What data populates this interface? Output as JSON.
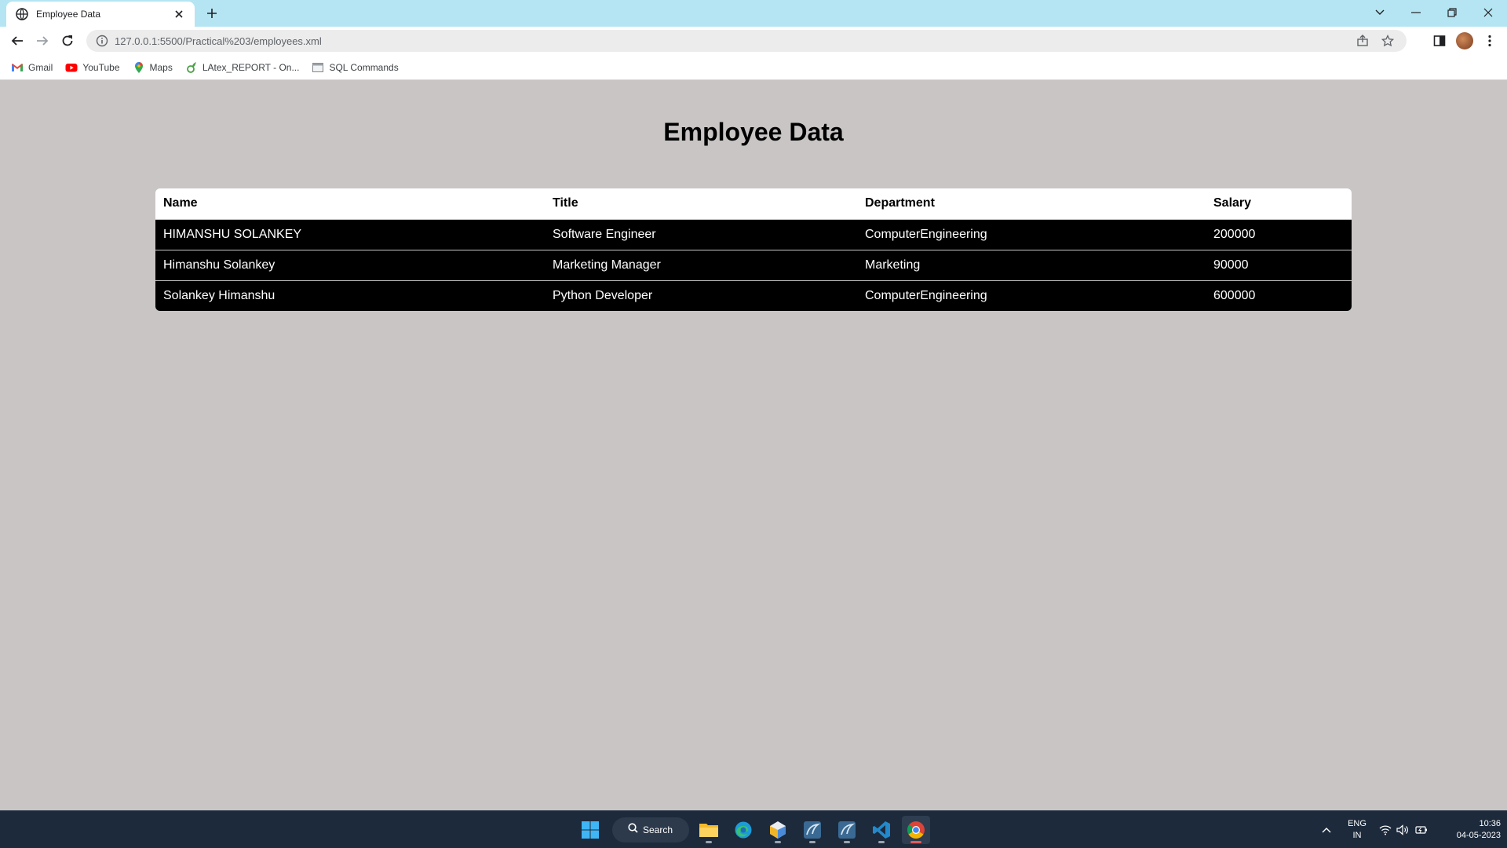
{
  "browser": {
    "tab_title": "Employee Data",
    "url": "127.0.0.1:5500/Practical%203/employees.xml",
    "bookmarks": [
      {
        "label": "Gmail",
        "icon": "gmail-icon"
      },
      {
        "label": "YouTube",
        "icon": "youtube-icon"
      },
      {
        "label": "Maps",
        "icon": "maps-icon"
      },
      {
        "label": "LAtex_REPORT - On...",
        "icon": "overleaf-icon"
      },
      {
        "label": "SQL Commands",
        "icon": "page-icon"
      }
    ]
  },
  "page": {
    "title": "Employee Data",
    "table": {
      "headers": [
        "Name",
        "Title",
        "Department",
        "Salary"
      ],
      "rows": [
        [
          "HIMANSHU SOLANKEY",
          "Software Engineer",
          "ComputerEngineering",
          "200000"
        ],
        [
          "Himanshu Solankey",
          "Marketing Manager",
          "Marketing",
          "90000"
        ],
        [
          "Solankey Himanshu",
          "Python Developer",
          "ComputerEngineering",
          "600000"
        ]
      ]
    }
  },
  "taskbar": {
    "search_label": "Search",
    "language": "ENG",
    "region": "IN",
    "time": "10:36",
    "date": "04-05-2023"
  },
  "colors": {
    "page_background": "#c9c5c5",
    "tab_strip": "#b5e5f2",
    "table_header_bg": "#ffffff",
    "table_row_bg": "#000000",
    "taskbar": "#1c2a3c"
  }
}
